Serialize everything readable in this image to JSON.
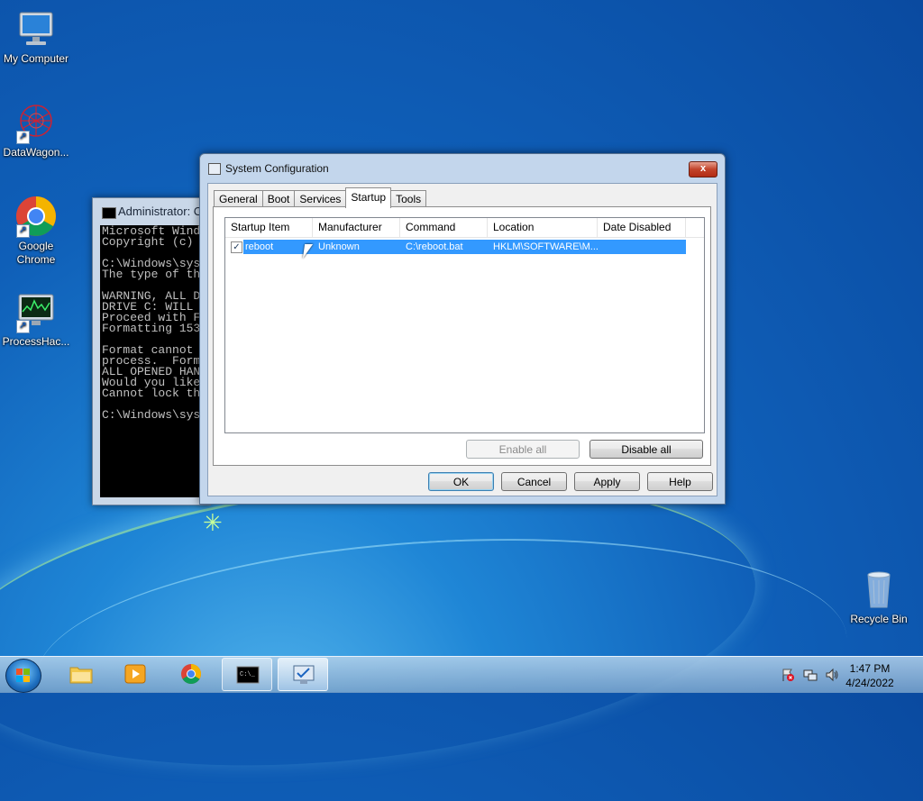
{
  "desktop": {
    "icons": [
      {
        "label": "My Computer"
      },
      {
        "label": "DataWagon..."
      },
      {
        "label": "Google Chrome"
      },
      {
        "label": "ProcessHac..."
      },
      {
        "label": "Recycle Bin"
      }
    ]
  },
  "cmd": {
    "title": "Administrator: C",
    "lines": "Microsoft Wind\nCopyright (c)\n\nC:\\Windows\\sys\nThe type of th\n\nWARNING, ALL D\nDRIVE C: WILL\nProceed with F\nFormatting 153\n\nFormat cannot\nprocess.  Form\nALL OPENED HAN\nWould you like\nCannot lock th\n\nC:\\Windows\\sys"
  },
  "dialog": {
    "title": "System Configuration",
    "close_label": "x",
    "tabs": [
      "General",
      "Boot",
      "Services",
      "Startup",
      "Tools"
    ],
    "active_tab": "Startup",
    "columns": [
      "Startup Item",
      "Manufacturer",
      "Command",
      "Location",
      "Date Disabled"
    ],
    "rows": [
      {
        "checked": true,
        "item": "reboot",
        "manufacturer": "Unknown",
        "command": "C:\\reboot.bat",
        "location": "HKLM\\SOFTWARE\\M...",
        "date_disabled": ""
      }
    ],
    "enable_all": "Enable all",
    "disable_all": "Disable all",
    "ok": "OK",
    "cancel": "Cancel",
    "apply": "Apply",
    "help": "Help"
  },
  "taskbar": {
    "time": "1:47 PM",
    "date": "4/24/2022"
  }
}
